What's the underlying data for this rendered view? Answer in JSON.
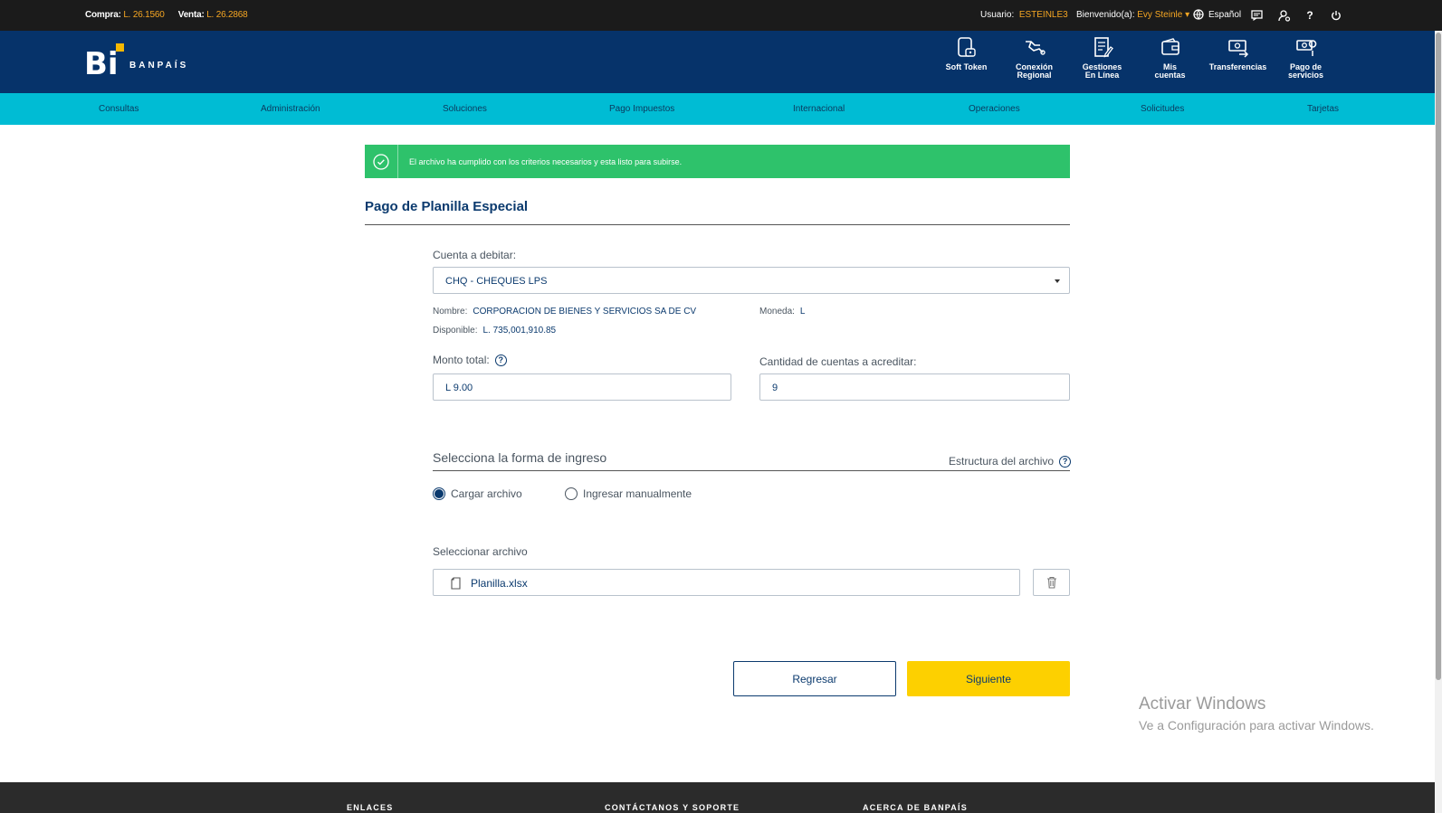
{
  "topbar": {
    "compra_label": "Compra:",
    "compra_value": "L. 26.1560",
    "venta_label": "Venta:",
    "venta_value": "L. 26.2868",
    "usuario_label": "Usuario:",
    "usuario_value": "ESTEINLE3",
    "bienvenido_label": "Bienvenido(a):",
    "bienvenido_value": "Evy Steinle",
    "language": "Español",
    "help": "?"
  },
  "header": {
    "logo_letter": "Bi",
    "logo_text": "BANPAÍS",
    "icons": [
      {
        "line1": "Soft Token",
        "line2": "",
        "icon": "soft-token-icon"
      },
      {
        "line1": "Conexión",
        "line2": "Regional",
        "icon": "regional-connection-icon"
      },
      {
        "line1": "Gestiones",
        "line2": "En Línea",
        "icon": "online-management-icon"
      },
      {
        "line1": "Mis",
        "line2": "cuentas",
        "icon": "wallet-icon"
      },
      {
        "line1": "Transferencias",
        "line2": "",
        "icon": "transfer-icon"
      },
      {
        "line1": "Pago de",
        "line2": "servicios",
        "icon": "service-payment-icon"
      }
    ]
  },
  "nav": [
    "Consultas",
    "Administración",
    "Soluciones",
    "Pago Impuestos",
    "Internacional",
    "Operaciones",
    "Solicitudes",
    "Tarjetas"
  ],
  "alert": {
    "message": "El archivo ha cumplido con los criterios necesarios y esta listo para subirse.",
    "color": "#2ec26b"
  },
  "page": {
    "title": "Pago de Planilla Especial"
  },
  "form": {
    "cuenta_label": "Cuenta a debitar:",
    "cuenta_value": "CHQ - CHEQUES LPS",
    "nombre_label": "Nombre:",
    "nombre_value": "CORPORACION DE BIENES Y SERVICIOS SA DE CV",
    "moneda_label": "Moneda:",
    "moneda_value": "L",
    "disponible_label": "Disponible:",
    "disponible_value": "L. 735,001,910.85",
    "monto_label": "Monto total:",
    "monto_value": "L 9.00",
    "cantidad_label": "Cantidad de cuentas a acreditar:",
    "cantidad_value": "9"
  },
  "ingreso": {
    "title": "Selecciona la forma de ingreso",
    "estructura": "Estructura del archivo",
    "options": [
      {
        "label": "Cargar archivo",
        "selected": true
      },
      {
        "label": "Ingresar manualmente",
        "selected": false
      }
    ],
    "archivo_label": "Seleccionar archivo",
    "archivo_value": "Planilla.xlsx"
  },
  "buttons": {
    "back": "Regresar",
    "next": "Siguiente"
  },
  "watermark": {
    "line1": "Activar Windows",
    "line2": "Ve a Configuración para activar Windows."
  },
  "footer": [
    "ENLACES",
    "CONTÁCTANOS Y SOPORTE",
    "ACERCA DE BANPAÍS"
  ],
  "colors": {
    "header_blue": "#06336a",
    "nav_cyan": "#00bcd4",
    "accent_yellow": "#fdd000",
    "success_green": "#2ec26b"
  }
}
